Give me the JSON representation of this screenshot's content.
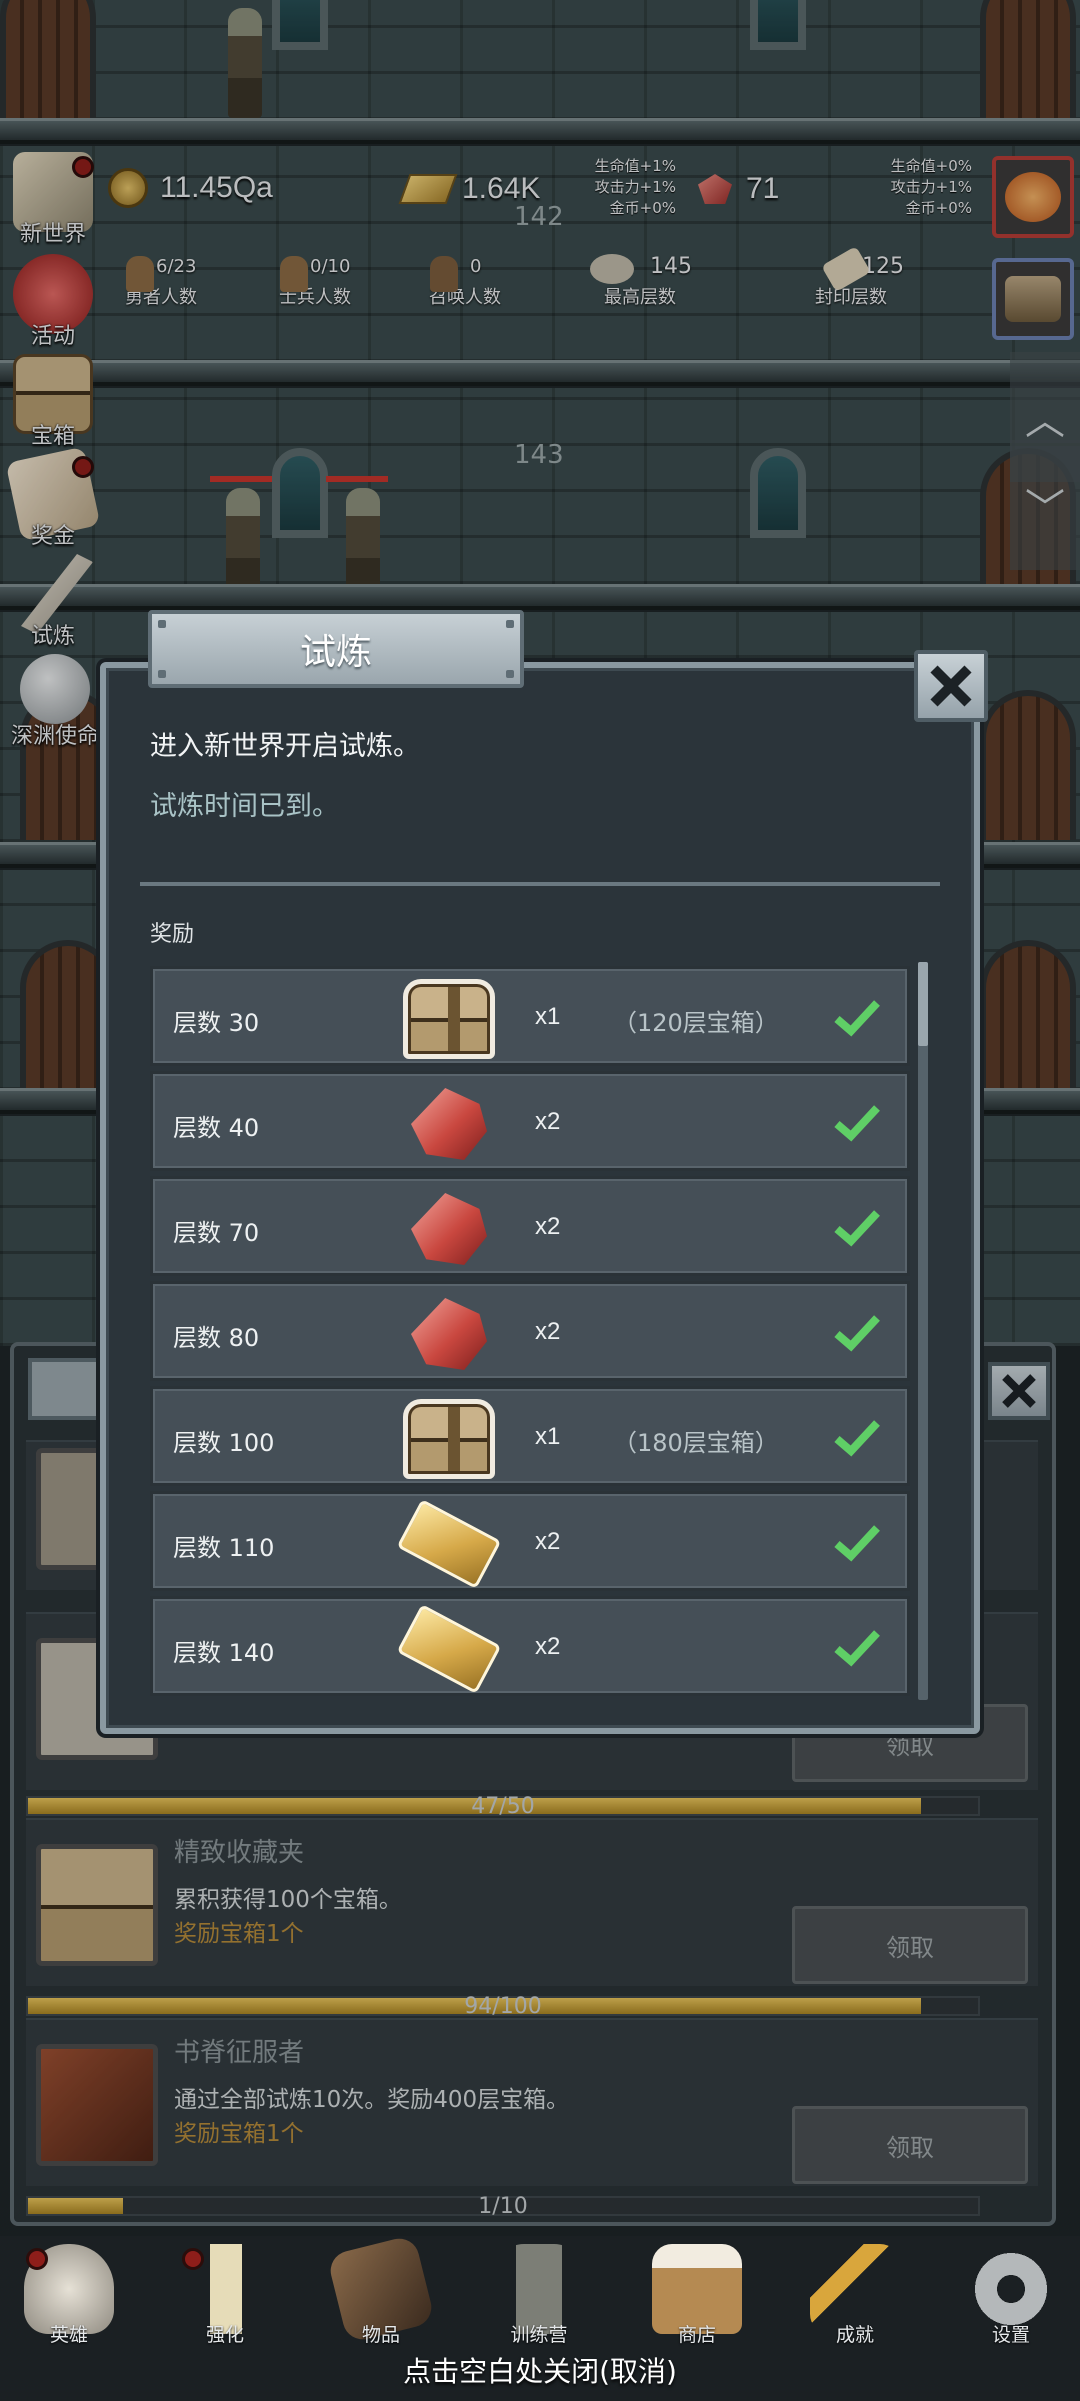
{
  "hud": {
    "gold": "11.45Qa",
    "gold_bars": "1.64K",
    "gems": "71",
    "buff_left": [
      "生命值+1%",
      "攻击力+1%",
      "金币+0%"
    ],
    "buff_right": [
      "生命值+0%",
      "攻击力+1%",
      "金币+0%"
    ],
    "stats": [
      {
        "value": "6/23",
        "label": "勇者人数"
      },
      {
        "value": "0/10",
        "label": "士兵人数"
      },
      {
        "value": "0",
        "label": "召唤人数"
      },
      {
        "value": "145",
        "label": "最高层数"
      },
      {
        "value": "125",
        "label": "封印层数"
      }
    ]
  },
  "floors": {
    "upper": "142",
    "lower": "143"
  },
  "sidebar": [
    {
      "label": "新世界",
      "icon": "world-map-icon",
      "dot": true
    },
    {
      "label": "活动",
      "icon": "heart-icon",
      "dot": false
    },
    {
      "label": "宝箱",
      "icon": "chest-icon",
      "dot": false
    },
    {
      "label": "奖金",
      "icon": "envelope-icon",
      "dot": true
    },
    {
      "label": "试炼",
      "icon": "feather-icon",
      "dot": false
    },
    {
      "label": "深渊使命",
      "icon": "orb-icon",
      "dot": false
    }
  ],
  "dialog": {
    "title": "试炼",
    "line1": "进入新世界开启试炼。",
    "line2": "试炼时间已到。",
    "section": "奖励",
    "rows": [
      {
        "level": "层数 30",
        "item": "chest",
        "qty": "x1",
        "note": "（120层宝箱）"
      },
      {
        "level": "层数 40",
        "item": "gem",
        "qty": "x2",
        "note": ""
      },
      {
        "level": "层数 70",
        "item": "gem",
        "qty": "x2",
        "note": ""
      },
      {
        "level": "层数 80",
        "item": "gem",
        "qty": "x2",
        "note": ""
      },
      {
        "level": "层数 100",
        "item": "chest",
        "qty": "x1",
        "note": "（180层宝箱）"
      },
      {
        "level": "层数 110",
        "item": "goldbar",
        "qty": "x2",
        "note": ""
      },
      {
        "level": "层数 140",
        "item": "goldbar",
        "qty": "x2",
        "note": ""
      }
    ]
  },
  "achievements": {
    "partial_btn": "领取",
    "partial_progress": {
      "text": "47/50",
      "fraction": 0.94
    },
    "items": [
      {
        "title": "精致收藏夹",
        "desc": "累积获得100个宝箱。",
        "reward": "奖励宝箱1个",
        "button": "领取",
        "progress_text": "94/100",
        "fraction": 0.94
      },
      {
        "title": "书脊征服者",
        "desc": "通过全部试炼10次。奖励400层宝箱。",
        "reward": "奖励宝箱1个",
        "button": "领取",
        "progress_text": "1/10",
        "fraction": 0.1
      }
    ]
  },
  "nav": [
    {
      "label": "英雄",
      "icon": "skull-icon",
      "dot": true
    },
    {
      "label": "强化",
      "icon": "candle-icon",
      "dot": true
    },
    {
      "label": "物品",
      "icon": "book-icon",
      "dot": false
    },
    {
      "label": "训练营",
      "icon": "lantern-icon",
      "dot": false
    },
    {
      "label": "商店",
      "icon": "mug-icon",
      "dot": false
    },
    {
      "label": "成就",
      "icon": "key-icon",
      "dot": false
    },
    {
      "label": "设置",
      "icon": "gear-icon",
      "dot": false
    }
  ],
  "dismiss_hint": "点击空白处关闭(取消)"
}
